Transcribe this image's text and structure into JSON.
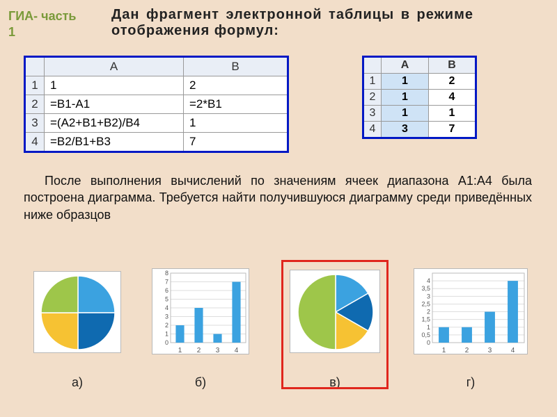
{
  "header": {
    "label_line1": "ГИА- часть",
    "label_line2": "1",
    "title": "Дан фрагмент электронной таблицы в режиме отображения формул:"
  },
  "formula_table": {
    "cols": [
      "",
      "A",
      "B"
    ],
    "rows": [
      {
        "n": "1",
        "A": "1",
        "B": "2"
      },
      {
        "n": "2",
        "A": "=B1-A1",
        "B": "=2*B1"
      },
      {
        "n": "3",
        "A": "=(A2+B1+B2)/B4",
        "B": "1"
      },
      {
        "n": "4",
        "A": "=B2/B1+B3",
        "B": "7"
      }
    ]
  },
  "values_table": {
    "cols": [
      "",
      "A",
      "B"
    ],
    "rows": [
      {
        "n": "1",
        "A": "1",
        "B": "2"
      },
      {
        "n": "2",
        "A": "1",
        "B": "4"
      },
      {
        "n": "3",
        "A": "1",
        "B": "1"
      },
      {
        "n": "4",
        "A": "3",
        "B": "7"
      }
    ]
  },
  "body_text": "После выполнения вычислений по значениям ячеек диапазона A1:A4 была построена диаграмма. Требуется найти получившуюся диаграмму среди приведённых ниже образцов",
  "options": {
    "a": "а)",
    "b": "б)",
    "v": "в)",
    "g": "г)"
  },
  "chart_data": [
    {
      "id": "a",
      "type": "pie",
      "categories": [
        "1",
        "2",
        "3",
        "4"
      ],
      "values": [
        1,
        1,
        1,
        1
      ],
      "colors": [
        "#3ba2e0",
        "#0f6ab0",
        "#f6c233",
        "#9ec64a"
      ],
      "title": ""
    },
    {
      "id": "b",
      "type": "bar",
      "categories": [
        "1",
        "2",
        "3",
        "4"
      ],
      "values": [
        2,
        4,
        1,
        7
      ],
      "ylim": [
        0,
        8
      ],
      "yticks": [
        0,
        1,
        2,
        3,
        4,
        5,
        6,
        7,
        8
      ],
      "title": ""
    },
    {
      "id": "v",
      "type": "pie",
      "categories": [
        "1",
        "2",
        "3",
        "4"
      ],
      "values": [
        1,
        1,
        1,
        3
      ],
      "colors": [
        "#3ba2e0",
        "#0f6ab0",
        "#f6c233",
        "#9ec64a"
      ],
      "title": ""
    },
    {
      "id": "g",
      "type": "bar",
      "categories": [
        "1",
        "2",
        "3",
        "4"
      ],
      "values": [
        1,
        1,
        2,
        4
      ],
      "ylim": [
        0,
        4.5
      ],
      "yticks": [
        0,
        0.5,
        1,
        1.5,
        2,
        2.5,
        3,
        3.5,
        4
      ],
      "title": ""
    }
  ],
  "correct": "v"
}
